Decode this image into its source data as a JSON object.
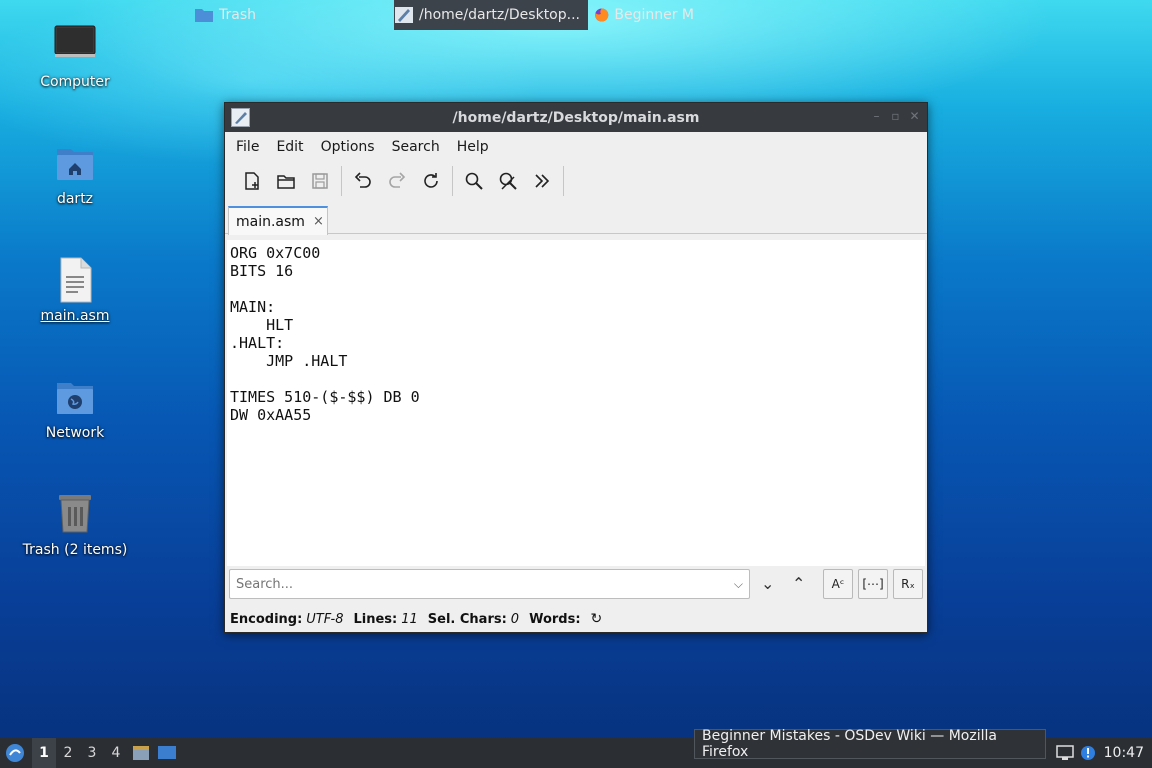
{
  "desktop": {
    "icons": [
      {
        "label": "Computer",
        "icon": "computer-icon"
      },
      {
        "label": "dartz",
        "icon": "home-folder-icon"
      },
      {
        "label": "main.asm",
        "icon": "text-file-icon"
      },
      {
        "label": "Network",
        "icon": "network-folder-icon"
      },
      {
        "label": "Trash (2 items)",
        "icon": "trash-icon"
      }
    ]
  },
  "window": {
    "title": "/home/dartz/Desktop/main.asm",
    "menu": [
      "File",
      "Edit",
      "Options",
      "Search",
      "Help"
    ],
    "toolbar": [
      "new-file-icon",
      "open-folder-icon",
      "save-icon",
      "undo-icon",
      "redo-icon",
      "reload-icon",
      "find-icon",
      "replace-icon",
      "more-icon"
    ],
    "tab": {
      "label": "main.asm",
      "close": "×"
    },
    "editor_lines": [
      "ORG 0x7C00",
      "BITS 16",
      "",
      "MAIN:",
      "    HLT",
      ".HALT:",
      "    JMP .HALT",
      "",
      "TIMES 510-($-$$) DB 0",
      "DW 0xAA55"
    ],
    "find": {
      "placeholder": "Search...",
      "dropdown": "⌵",
      "down": "⌄",
      "up": "⌃",
      "opt_case": "Aᶜ",
      "opt_whole": "[⋯]",
      "opt_regex": "Rₓ"
    },
    "status": {
      "encoding_label": "Encoding:",
      "encoding_value": "UTF-8",
      "lines_label": "Lines:",
      "lines_value": "11",
      "sel_label": "Sel. Chars:",
      "sel_value": "0",
      "words_label": "Words:",
      "refresh": "↻"
    }
  },
  "taskbar": {
    "workspaces": [
      "1",
      "2",
      "3",
      "4"
    ],
    "tasks": [
      {
        "label": "Trash",
        "icon": "folder-icon"
      },
      {
        "label": "/home/dartz/Desktop...",
        "icon": "text-editor-icon"
      },
      {
        "label": "Beginner M",
        "icon": "firefox-icon"
      }
    ],
    "tooltip": "Beginner Mistakes - OSDev Wiki — Mozilla Firefox",
    "clock": "10:47"
  },
  "colors": {
    "accent": "#4f8fe0",
    "titlebar": "#373b40",
    "taskbar": "#2b2f34"
  }
}
